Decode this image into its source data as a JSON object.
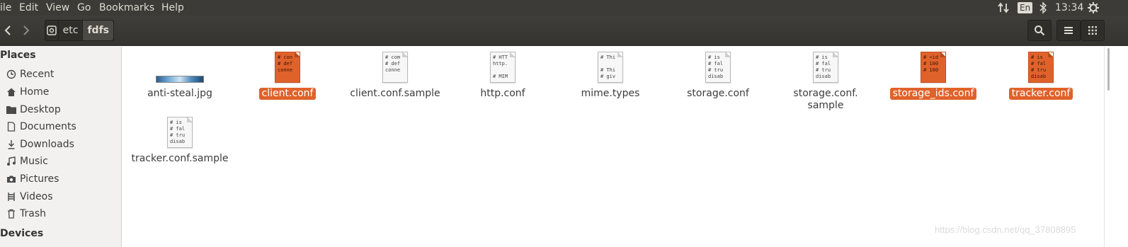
{
  "menubar": {
    "items": [
      "ile",
      "Edit",
      "View",
      "Go",
      "Bookmarks",
      "Help"
    ],
    "indicators": {
      "network_icon": "updown-arrows-icon",
      "lang": "En",
      "bluetooth_icon": "bluetooth-icon",
      "time": "13:34",
      "settings_icon": "gear-icon"
    }
  },
  "toolbar": {
    "back_icon": "chevron-left-icon",
    "forward_icon": "chevron-right-icon",
    "path": [
      "etc",
      "fdfs"
    ],
    "search_icon": "search-icon",
    "list_view_icon": "list-icon",
    "grid_view_icon": "grid-icon"
  },
  "sidebar": {
    "places_heading": "Places",
    "items": [
      {
        "label": "Recent",
        "icon": "clock-icon"
      },
      {
        "label": "Home",
        "icon": "home-icon"
      },
      {
        "label": "Desktop",
        "icon": "folder-icon"
      },
      {
        "label": "Documents",
        "icon": "document-icon"
      },
      {
        "label": "Downloads",
        "icon": "download-icon"
      },
      {
        "label": "Music",
        "icon": "music-icon"
      },
      {
        "label": "Pictures",
        "icon": "camera-icon"
      },
      {
        "label": "Videos",
        "icon": "film-icon"
      },
      {
        "label": "Trash",
        "icon": "trash-icon"
      }
    ],
    "devices_heading": "Devices"
  },
  "files": [
    {
      "name": "anti-steal.jpg",
      "type": "image",
      "selected": false,
      "preview": []
    },
    {
      "name": "client.conf",
      "type": "text",
      "selected": true,
      "preview": [
        "# con",
        "# def",
        "conne"
      ]
    },
    {
      "name": "client.conf.sample",
      "type": "text",
      "selected": false,
      "preview": [
        "# com",
        "# def",
        "conne"
      ]
    },
    {
      "name": "http.conf",
      "type": "text",
      "selected": false,
      "preview": [
        "# HTT",
        "http.",
        "",
        "# MIM"
      ]
    },
    {
      "name": "mime.types",
      "type": "text",
      "selected": false,
      "preview": [
        "# Thi",
        "",
        "# Thi",
        "# giv"
      ]
    },
    {
      "name": "storage.conf",
      "type": "text",
      "selected": false,
      "preview": [
        "# is",
        "# fal",
        "# tru",
        "disab"
      ]
    },
    {
      "name": "storage.conf.\nsample",
      "type": "text",
      "selected": false,
      "preview": [
        "# is",
        "# fal",
        "# tru",
        "disab"
      ]
    },
    {
      "name": "storage_ids.conf",
      "type": "text",
      "selected": true,
      "preview": [
        "# <id",
        "# 100",
        "# 100"
      ]
    },
    {
      "name": "tracker.conf",
      "type": "text",
      "selected": true,
      "preview": [
        "# is",
        "# fal",
        "# tru",
        "disab"
      ]
    },
    {
      "name": "tracker.conf.sample",
      "type": "text",
      "selected": false,
      "preview": [
        "# is",
        "# fal",
        "# tru",
        "disab"
      ]
    }
  ],
  "watermark": "https://blog.csdn.net/qq_37808895",
  "colors": {
    "accent": "#e0622b",
    "toolbar": "#3c3b37",
    "sidebar": "#f2f1f0"
  }
}
